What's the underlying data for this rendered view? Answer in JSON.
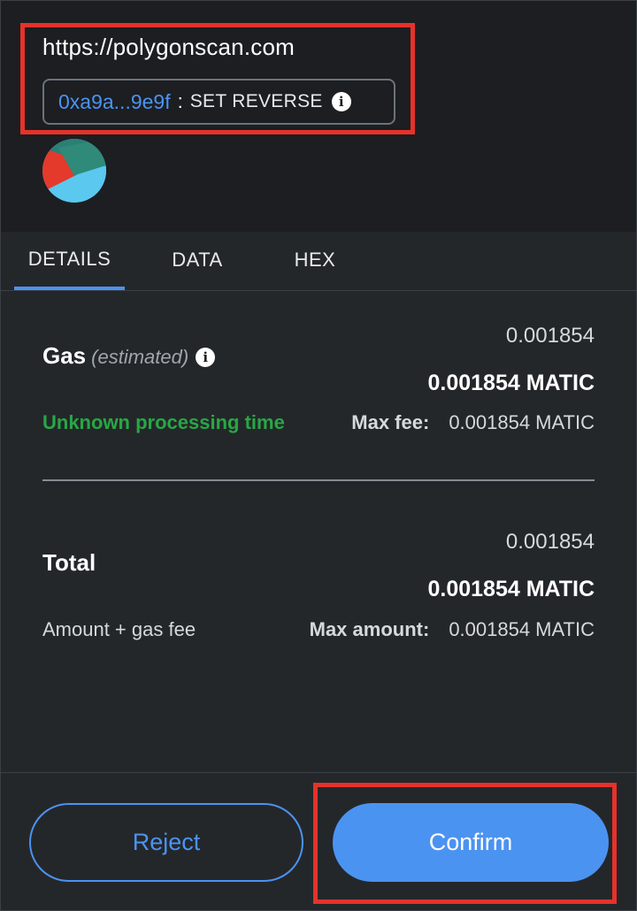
{
  "header": {
    "origin": "https://polygonscan.com",
    "address": "0xa9a...9e9f",
    "separator": ":",
    "method": "SET REVERSE"
  },
  "tabs": [
    {
      "label": "DETAILS",
      "active": true
    },
    {
      "label": "DATA",
      "active": false
    },
    {
      "label": "HEX",
      "active": false
    }
  ],
  "gas": {
    "label": "Gas",
    "estimated": "(estimated)",
    "value": "0.001854",
    "value_bold": "0.001854 MATIC",
    "processing_time": "Unknown processing time",
    "max_fee_label": "Max fee:",
    "max_fee_value": "0.001854 MATIC"
  },
  "total": {
    "label": "Total",
    "value": "0.001854",
    "value_bold": "0.001854 MATIC",
    "sub_label": "Amount + gas fee",
    "max_amount_label": "Max amount:",
    "max_amount_value": "0.001854 MATIC"
  },
  "buttons": {
    "reject": "Reject",
    "confirm": "Confirm"
  },
  "colors": {
    "accent": "#4b93f1",
    "success": "#28a745",
    "highlight": "#e5322b",
    "background": "#24272a"
  },
  "icons": [
    "info-icon",
    "account-avatar"
  ]
}
